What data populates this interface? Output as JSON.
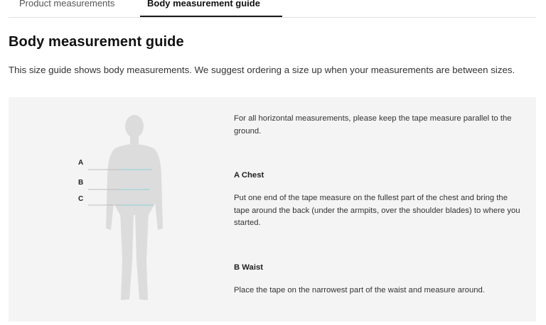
{
  "tabs": {
    "product_label": "Product measurements",
    "body_label": "Body measurement guide"
  },
  "header": {
    "title": "Body measurement guide",
    "intro": "This size guide shows body measurements. We suggest ordering a size up when your measurements are between sizes."
  },
  "figure": {
    "markers": [
      "A",
      "B",
      "C"
    ],
    "line_color": "#8ecfd4",
    "silhouette_color": "#dcdcdc"
  },
  "guide": {
    "general": "For all horizontal measurements, please keep the tape measure parallel to the ground.",
    "chest_heading": "A Chest",
    "chest_text": "Put one end of the tape measure on the fullest part of the chest and bring the tape around the back (under the armpits, over the shoulder blades) to where you started.",
    "waist_heading": "B Waist",
    "waist_text": "Place the tape on the narrowest part of the waist and measure around."
  }
}
